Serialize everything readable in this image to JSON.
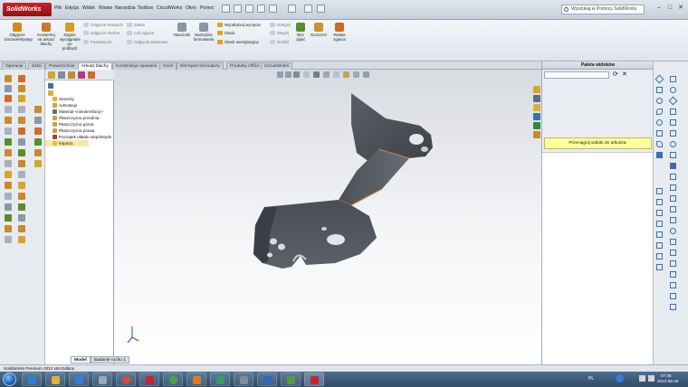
{
  "app": {
    "logo": "SolidWorks",
    "menu": [
      "Plik",
      "Edycja",
      "Widok",
      "Wstaw",
      "Narzędzia",
      "Toolbox",
      "CircuitWorks",
      "Okno",
      "Pomoc"
    ],
    "search_placeholder": "Wyszukaj w Pomocy SolidWorks",
    "window_controls": [
      "–",
      "□",
      "✕"
    ]
  },
  "command_manager": {
    "large": [
      {
        "label": "Odgięcie bazowe/Występ",
        "color": "#d28a1e"
      },
      {
        "label": "Konwertuj na arkusz blachy",
        "color": "#c97a2a"
      },
      {
        "label": "Zagnie wyciągnięte po profilach",
        "color": "#d79a25"
      }
    ],
    "group1": [
      "Odgięcie krawędzi",
      "Odgięcie skośne",
      "Podwinięcie"
    ],
    "group2": [
      "Załam",
      "Łuk zgięcia",
      "Odgięcie pasmowe"
    ],
    "mid": [
      {
        "label": "Narożniki",
        "color": "#8a96a6"
      },
      {
        "label": "Narzędzie formowania",
        "color": "#8a96a6"
      }
    ],
    "group3": [
      "Wyodrębnij wycięcia",
      "Otwór",
      "Otwór wentylacyjny"
    ],
    "group4": [
      "Odegnij",
      "Złegnij",
      "Rozłóż"
    ],
    "right": [
      {
        "label": "Bez zgięć",
        "color": "#5a8c2a"
      },
      {
        "label": "Rozszerz",
        "color": "#c99528"
      },
      {
        "label": "Wstaw zgięcia",
        "color": "#c96a28"
      }
    ]
  },
  "tabs": [
    "Operacje",
    "Szkic",
    "Powierzchnie",
    "Arkusz blachy",
    "Konstrukcje spawane",
    "Oceń",
    "DimXpert formularzy",
    "Produkty Office",
    "CircuitWorks"
  ],
  "active_tab": "Arkusz blachy",
  "tree": {
    "items": [
      {
        "label": "Sensory",
        "color": "#e0b030",
        "indent": 8
      },
      {
        "label": "Adnotacje",
        "color": "#d7a72c",
        "indent": 8
      },
      {
        "label": "Materiał <nieokreślony>",
        "color": "#5c6e82",
        "indent": 8
      },
      {
        "label": "Płaszczyzna przednia",
        "color": "#c8a24a",
        "indent": 8
      },
      {
        "label": "Płaszczyzna górna",
        "color": "#c8a24a",
        "indent": 8
      },
      {
        "label": "Płaszczyzna prawa",
        "color": "#c8a24a",
        "indent": 8
      },
      {
        "label": "Początek układu współrzędn",
        "color": "#b33a3a",
        "indent": 8
      },
      {
        "label": "Import1",
        "color": "#e0c040",
        "indent": 8
      }
    ]
  },
  "palette": {
    "title": "Paleta widoków",
    "message": "Przeciągnij widoki do arkusza.",
    "buttons": [
      "⟳",
      "✕"
    ]
  },
  "bottom_tabs": [
    "Model",
    "Badanie ruchu 1"
  ],
  "status": "SolidWorks Premium 2012 x64 Edition",
  "taskbar": {
    "lang": "PL",
    "time": "07:46",
    "date": "2013-05-26"
  }
}
